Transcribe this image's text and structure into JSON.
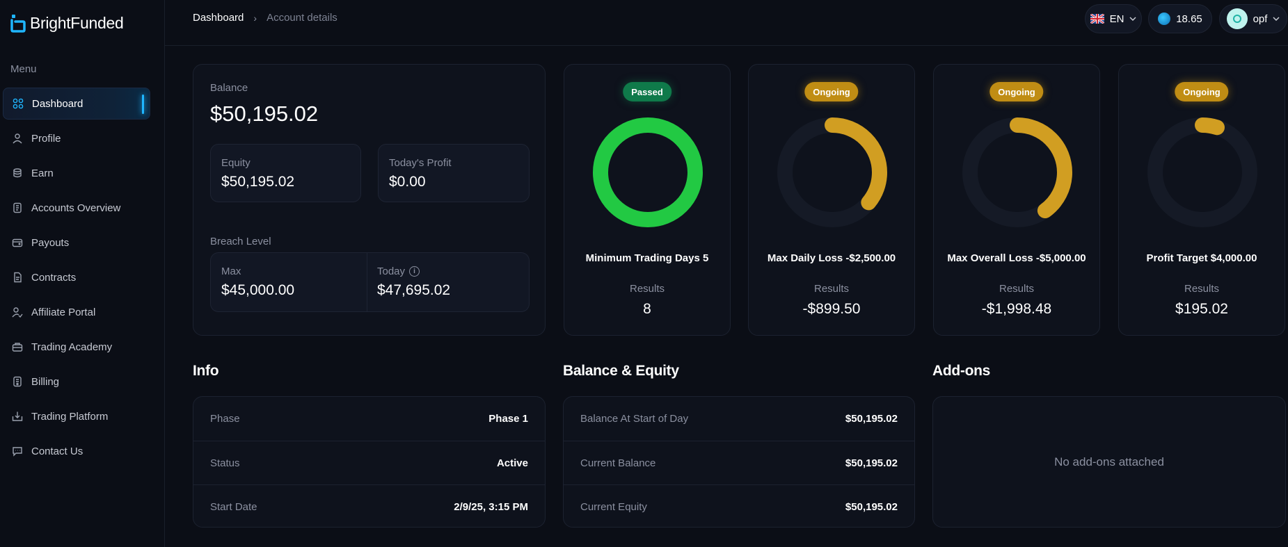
{
  "app": {
    "brand": "BrightFunded"
  },
  "sidebar": {
    "menu_label": "Menu",
    "items": [
      {
        "label": "Dashboard",
        "icon": "dashboard-icon",
        "active": true
      },
      {
        "label": "Profile",
        "icon": "user-icon"
      },
      {
        "label": "Earn",
        "icon": "coins-icon"
      },
      {
        "label": "Accounts Overview",
        "icon": "document-icon"
      },
      {
        "label": "Payouts",
        "icon": "wallet-icon"
      },
      {
        "label": "Contracts",
        "icon": "contract-icon"
      },
      {
        "label": "Affiliate Portal",
        "icon": "affiliate-icon"
      },
      {
        "label": "Trading Academy",
        "icon": "academy-icon"
      },
      {
        "label": "Billing",
        "icon": "billing-icon"
      },
      {
        "label": "Trading Platform",
        "icon": "platform-icon"
      },
      {
        "label": "Contact Us",
        "icon": "chat-icon"
      }
    ]
  },
  "header": {
    "breadcrumb": {
      "home": "Dashboard",
      "separator": "›",
      "current": "Account details"
    },
    "language": "EN",
    "coin_balance": "18.65",
    "username": "opf"
  },
  "balance": {
    "label": "Balance",
    "value": "$50,195.02",
    "equity_label": "Equity",
    "equity_value": "$50,195.02",
    "profit_label": "Today's Profit",
    "profit_value": "$0.00",
    "breach_label": "Breach Level",
    "max_label": "Max",
    "max_value": "$45,000.00",
    "today_label": "Today",
    "today_value": "$47,695.02"
  },
  "objectives": [
    {
      "status": "Passed",
      "title": "Minimum Trading Days 5",
      "results_label": "Results",
      "results": "8",
      "progress": 1.0,
      "color": "#22c943"
    },
    {
      "status": "Ongoing",
      "title": "Max Daily Loss -$2,500.00",
      "results_label": "Results",
      "results": "-$899.50",
      "progress": 0.36,
      "color": "#d19e22"
    },
    {
      "status": "Ongoing",
      "title": "Max Overall Loss -$5,000.00",
      "results_label": "Results",
      "results": "-$1,998.48",
      "progress": 0.4,
      "color": "#d19e22"
    },
    {
      "status": "Ongoing",
      "title": "Profit Target $4,000.00",
      "results_label": "Results",
      "results": "$195.02",
      "progress": 0.05,
      "color": "#d19e22"
    }
  ],
  "info": {
    "title": "Info",
    "rows": [
      {
        "label": "Phase",
        "value": "Phase 1"
      },
      {
        "label": "Status",
        "value": "Active"
      },
      {
        "label": "Start Date",
        "value": "2/9/25, 3:15 PM"
      }
    ]
  },
  "balance_equity": {
    "title": "Balance & Equity",
    "rows": [
      {
        "label": "Balance At Start of Day",
        "value": "$50,195.02"
      },
      {
        "label": "Current Balance",
        "value": "$50,195.02"
      },
      {
        "label": "Current Equity",
        "value": "$50,195.02"
      }
    ]
  },
  "addons": {
    "title": "Add-ons",
    "empty_text": "No add-ons attached"
  },
  "colors": {
    "accent": "#1fb6ff",
    "passed": "#0f7a4a",
    "ongoing": "#c08d14",
    "ring_track": "#151a26"
  }
}
